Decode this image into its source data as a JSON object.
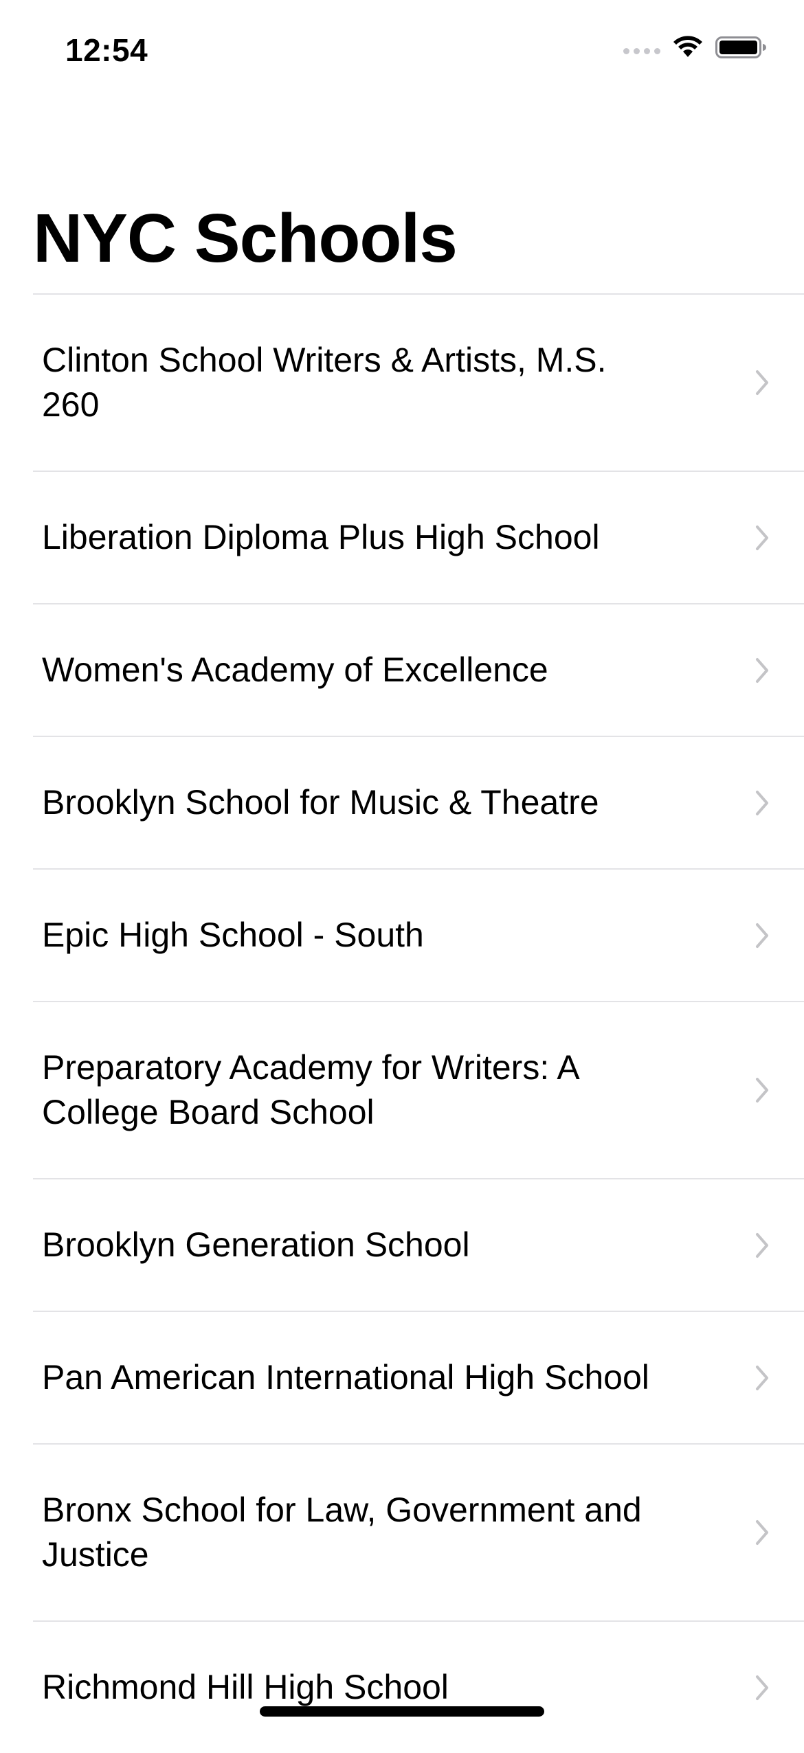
{
  "status_bar": {
    "time": "12:54",
    "icons": [
      "cellular-signal-icon",
      "wifi-icon",
      "battery-icon"
    ]
  },
  "navigation": {
    "title": "NYC Schools"
  },
  "schools": [
    {
      "name": "Clinton School Writers & Artists, M.S. 260"
    },
    {
      "name": "Liberation Diploma Plus High School"
    },
    {
      "name": "Women's Academy of Excellence"
    },
    {
      "name": "Brooklyn School for Music & Theatre"
    },
    {
      "name": "Epic High School - South"
    },
    {
      "name": "Preparatory Academy for Writers: A College Board School"
    },
    {
      "name": "Brooklyn Generation School"
    },
    {
      "name": "Pan American International High School"
    },
    {
      "name": "Bronx School for Law, Government and Justice"
    },
    {
      "name": "Richmond Hill High School"
    }
  ],
  "colors": {
    "separator": "#e3e3e6",
    "chevron": "#c4c4c7",
    "text": "#000000",
    "background": "#ffffff"
  }
}
